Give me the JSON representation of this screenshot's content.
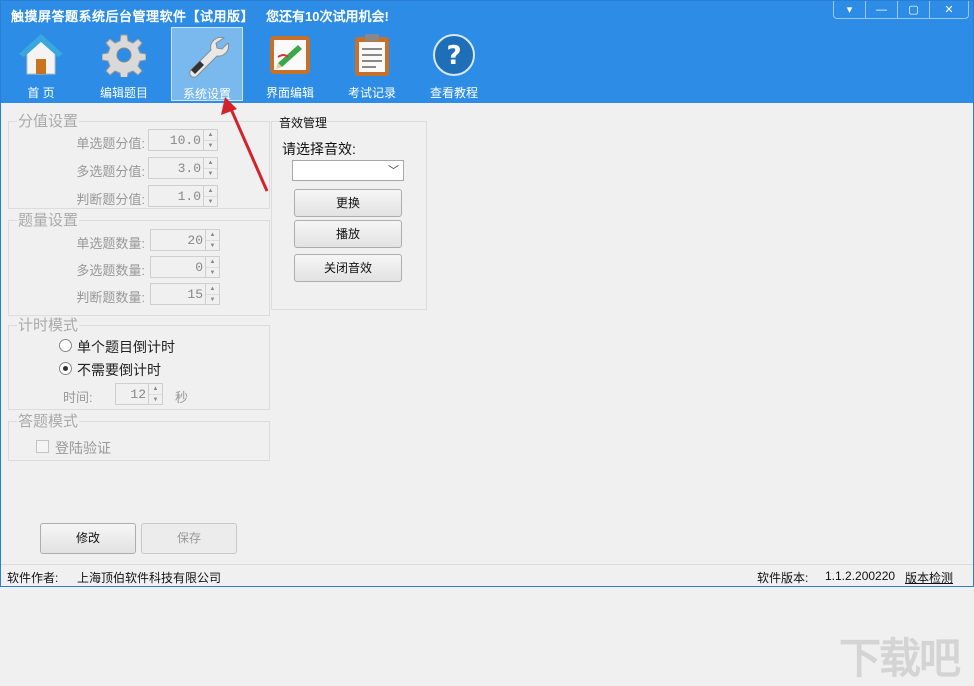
{
  "titlebar": {
    "app_title": "触摸屏答题系统后台管理软件【试用版】",
    "trial_message": "您还有10次试用机会!",
    "buttons": {
      "dropdown": "▾",
      "minimize": "—",
      "maximize": "▢",
      "close": "✕"
    }
  },
  "toolbar": {
    "items": [
      {
        "label": "首  页",
        "icon": "home-icon"
      },
      {
        "label": "编辑题目",
        "icon": "gear-icon"
      },
      {
        "label": "系统设置",
        "icon": "wrench-icon",
        "active": true
      },
      {
        "label": "界面编辑",
        "icon": "pencil-board-icon"
      },
      {
        "label": "考试记录",
        "icon": "clipboard-icon"
      },
      {
        "label": "查看教程",
        "icon": "help-icon"
      }
    ]
  },
  "score_settings": {
    "title": "分值设置",
    "rows": [
      {
        "label": "单选题分值:",
        "value": "10.0"
      },
      {
        "label": "多选题分值:",
        "value": "3.0"
      },
      {
        "label": "判断题分值:",
        "value": "1.0"
      }
    ]
  },
  "count_settings": {
    "title": "题量设置",
    "rows": [
      {
        "label": "单选题数量:",
        "value": "20"
      },
      {
        "label": "多选题数量:",
        "value": "0"
      },
      {
        "label": "判断题数量:",
        "value": "15"
      }
    ]
  },
  "timer_mode": {
    "title": "计时模式",
    "option_single": "单个题目倒计时",
    "option_none": "不需要倒计时",
    "selected": "option_none",
    "time_label": "时间:",
    "time_value": "12",
    "time_unit": "秒"
  },
  "answer_mode": {
    "title": "答题模式",
    "login_verify": "登陆验证",
    "login_verify_checked": false
  },
  "sound": {
    "title": "音效管理",
    "prompt": "请选择音效:",
    "selected": "",
    "btn_replace": "更换",
    "btn_play": "播放",
    "btn_close": "关闭音效"
  },
  "actions": {
    "modify": "修改",
    "save": "保存"
  },
  "status_bar": {
    "author_label": "软件作者:",
    "author": "上海顶伯软件科技有限公司",
    "version_label": "软件版本:",
    "version": "1.1.2.200220",
    "check_version": "版本检测"
  },
  "colors": {
    "accent": "#2d8de6",
    "annotation_arrow": "#d2232a"
  }
}
